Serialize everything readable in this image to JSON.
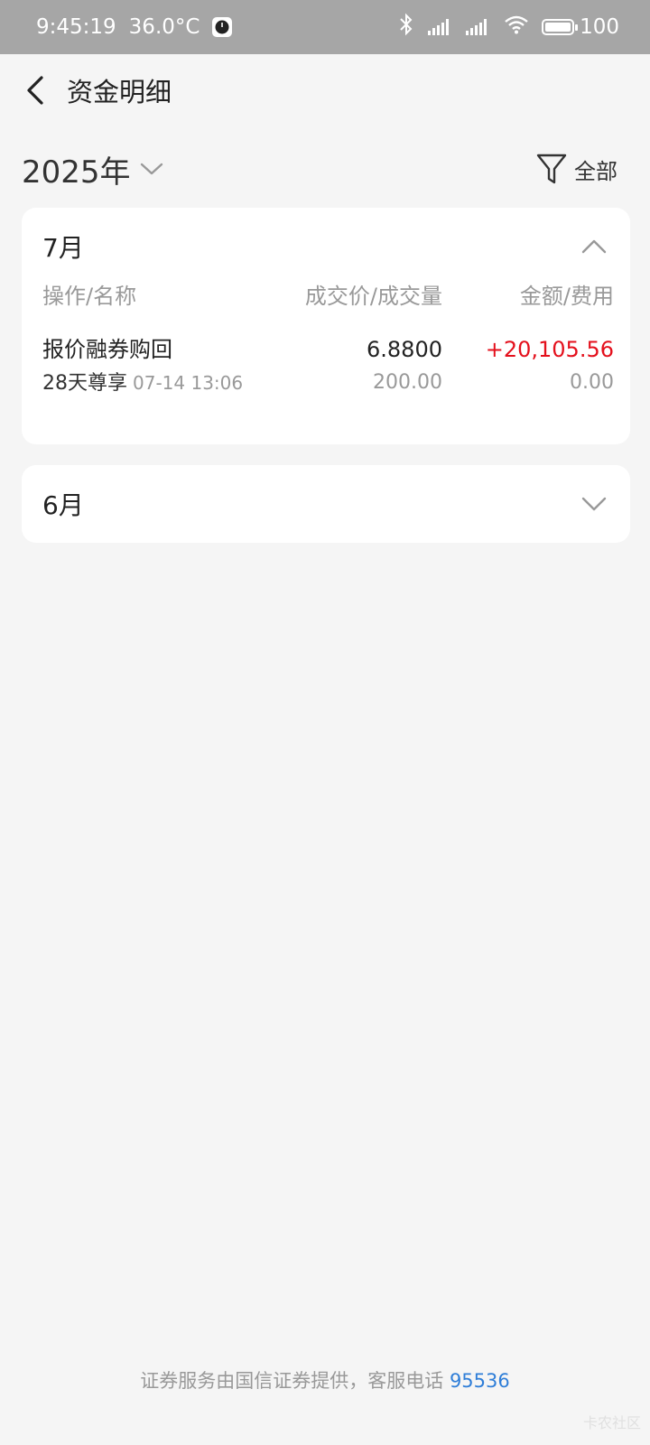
{
  "status_bar": {
    "time": "9:45:19",
    "temperature": "36.0°C",
    "battery": "100",
    "battery_level": 1.0
  },
  "header": {
    "title": "资金明细",
    "back_icon": "chevron-left-icon"
  },
  "filter_bar": {
    "year": "2025年",
    "filter_label": "全部",
    "filter_icon": "funnel-icon"
  },
  "months": {
    "jul": {
      "label": "7月",
      "expanded": true,
      "columns": [
        "操作/名称",
        "成交价/成交量",
        "金额/费用"
      ],
      "records": [
        {
          "operation": "报价融券购回",
          "name": "28天尊享",
          "time": "07-14 13:06",
          "price": "6.8800",
          "volume": "200.00",
          "amount": "+20,105.56",
          "fee": "0.00"
        }
      ]
    },
    "jun": {
      "label": "6月",
      "expanded": false
    }
  },
  "footer": {
    "text": "证券服务由国信证券提供，客服电话 ",
    "phone": "95536"
  },
  "watermark": "卡农社区",
  "colors": {
    "status_bar_bg": "#a6a6a6",
    "background": "#f5f5f5",
    "positive_amount": "#e4101c",
    "link": "#2f7ed8"
  }
}
